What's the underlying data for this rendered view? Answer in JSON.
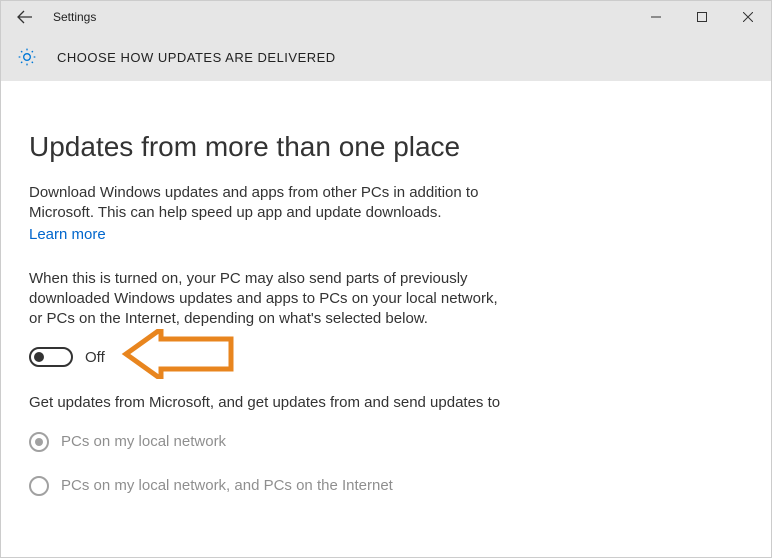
{
  "titlebar": {
    "title": "Settings"
  },
  "subheader": {
    "text": "CHOOSE HOW UPDATES ARE DELIVERED"
  },
  "page": {
    "heading": "Updates from more than one place",
    "desc1": "Download Windows updates and apps from other PCs in addition to Microsoft. This can help speed up app and update downloads.",
    "learn_more": "Learn more",
    "desc2": "When this is turned on, your PC may also send parts of previously downloaded Windows updates and apps to PCs on your local network, or PCs on the Internet, depending on what's selected below.",
    "toggle_state": "Off",
    "desc3": "Get updates from Microsoft, and get updates from and send updates to",
    "radio1": "PCs on my local network",
    "radio2": "PCs on my local network, and PCs on the Internet"
  },
  "colors": {
    "accent_annotation": "#e8851e"
  }
}
